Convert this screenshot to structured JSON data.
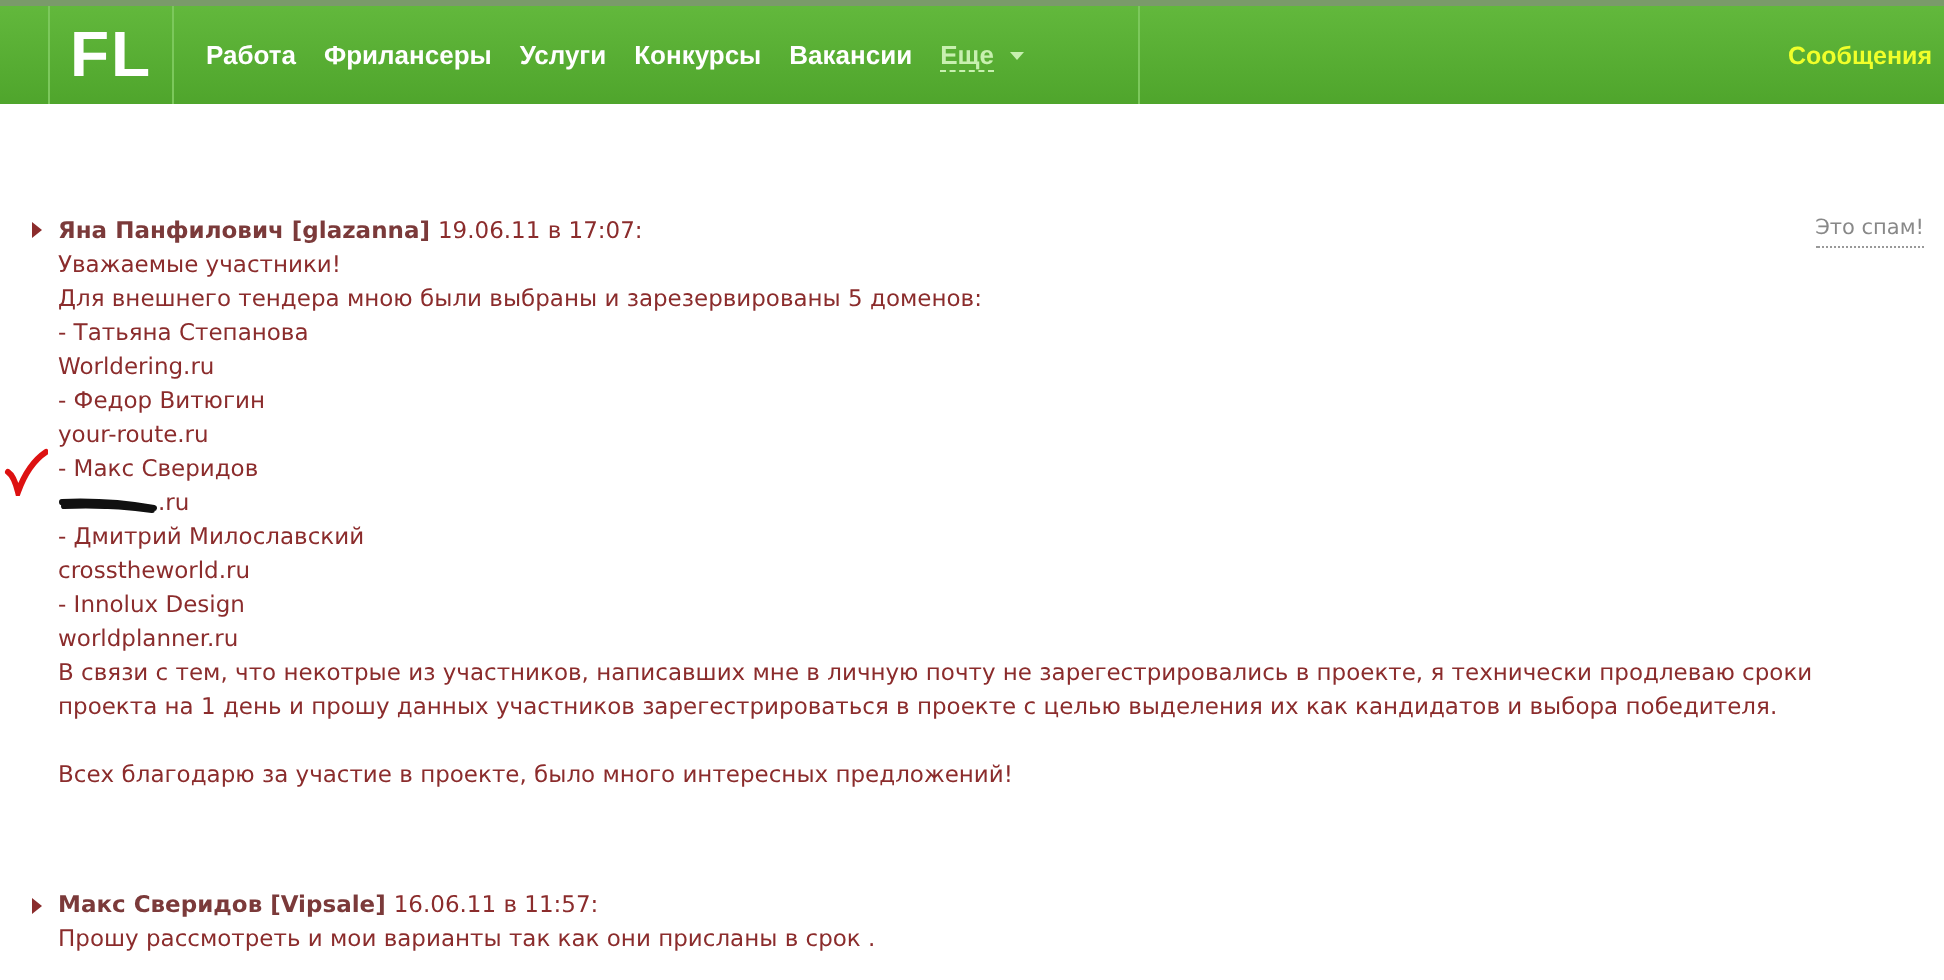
{
  "header": {
    "logo": "FL",
    "nav": [
      {
        "label": "Работа",
        "kind": "link"
      },
      {
        "label": "Фрилансеры",
        "kind": "link"
      },
      {
        "label": "Услуги",
        "kind": "link"
      },
      {
        "label": "Конкурсы",
        "kind": "link"
      },
      {
        "label": "Вакансии",
        "kind": "link"
      },
      {
        "label": "Еще",
        "kind": "dropdown"
      }
    ],
    "messages_link": "Сообщения"
  },
  "comments": [
    {
      "author": "Яна Панфилович [glazanna]",
      "date": "19.06.11 в 17:07:",
      "spam_link": "Это спам!",
      "lines": [
        {
          "text": "Уважаемые участники!"
        },
        {
          "text": "Для внешнего тендера мною были выбраны и зарезервированы 5 доменов:"
        },
        {
          "text": "- Татьяна Степанова"
        },
        {
          "text": "Worldering.ru"
        },
        {
          "text": "- Федор Витюгин"
        },
        {
          "text": "your-route.ru"
        },
        {
          "text": "- Макс Сверидов",
          "marked": true
        },
        {
          "text": ".ru",
          "redacted": true
        },
        {
          "text": "- Дмитрий Милославский"
        },
        {
          "text": "crosstheworld.ru"
        },
        {
          "text": "- Innolux Design"
        },
        {
          "text": "worldplanner.ru"
        }
      ],
      "paragraphs": [
        "В связи с тем, что некотрые из участников, написавших мне в личную почту не зарегестрировались в проекте, я технически продлеваю сроки проекта на 1 день и прошу данных участников зарегестрироваться в проекте с целью выделения их как кандидатов и выбора победителя.",
        "Всех благодарю за участие в проекте, было много интересных предложений!"
      ]
    },
    {
      "author": "Макс Сверидов [Vipsale]",
      "date": "16.06.11 в 11:57:",
      "lines": [
        {
          "text": "Прошу рассмотреть и мои варианты так как они присланы в срок ."
        }
      ]
    }
  ]
}
